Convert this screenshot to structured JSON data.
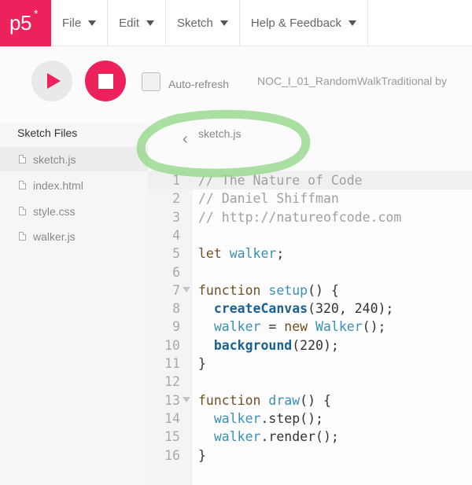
{
  "app": {
    "logo": "p5",
    "logo_star": "*",
    "brand_color": "#ed225d"
  },
  "nav": {
    "menus": [
      {
        "label": "File"
      },
      {
        "label": "Edit"
      },
      {
        "label": "Sketch"
      },
      {
        "label": "Help & Feedback"
      }
    ]
  },
  "toolbar": {
    "play_icon": "play-icon",
    "stop_icon": "stop-icon",
    "auto_refresh_label": "Auto-refresh",
    "auto_refresh_checked": false,
    "project_name": "NOC_I_01_RandomWalkTraditional  by"
  },
  "sidebar": {
    "title": "Sketch Files",
    "files": [
      {
        "name": "sketch.js",
        "active": true
      },
      {
        "name": "index.html",
        "active": false
      },
      {
        "name": "style.css",
        "active": false
      },
      {
        "name": "walker.js",
        "active": false
      }
    ]
  },
  "editor": {
    "back_icon": "chevron-left-icon",
    "open_file": "sketch.js",
    "highlight_color": "#9ad98f",
    "lines": [
      {
        "n": "1",
        "fold": false,
        "tokens": [
          {
            "t": "// The Nature of Code",
            "c": "comment"
          }
        ]
      },
      {
        "n": "2",
        "fold": false,
        "tokens": [
          {
            "t": "// Daniel Shiffman",
            "c": "comment"
          }
        ]
      },
      {
        "n": "3",
        "fold": false,
        "tokens": [
          {
            "t": "// http://natureofcode.com",
            "c": "comment"
          }
        ]
      },
      {
        "n": "4",
        "fold": false,
        "tokens": []
      },
      {
        "n": "5",
        "fold": false,
        "tokens": [
          {
            "t": "let ",
            "c": "kw"
          },
          {
            "t": "walker",
            "c": "var"
          },
          {
            "t": ";",
            "c": ""
          }
        ]
      },
      {
        "n": "6",
        "fold": false,
        "tokens": []
      },
      {
        "n": "7",
        "fold": true,
        "tokens": [
          {
            "t": "function ",
            "c": "kw"
          },
          {
            "t": "setup",
            "c": "var"
          },
          {
            "t": "() {",
            "c": ""
          }
        ]
      },
      {
        "n": "8",
        "fold": false,
        "tokens": [
          {
            "t": "  ",
            "c": ""
          },
          {
            "t": "createCanvas",
            "c": "fn"
          },
          {
            "t": "(320, 240);",
            "c": ""
          }
        ]
      },
      {
        "n": "9",
        "fold": false,
        "tokens": [
          {
            "t": "  ",
            "c": ""
          },
          {
            "t": "walker",
            "c": "var"
          },
          {
            "t": " = ",
            "c": ""
          },
          {
            "t": "new ",
            "c": "new"
          },
          {
            "t": "Walker",
            "c": "var"
          },
          {
            "t": "();",
            "c": ""
          }
        ]
      },
      {
        "n": "10",
        "fold": false,
        "tokens": [
          {
            "t": "  ",
            "c": ""
          },
          {
            "t": "background",
            "c": "fn"
          },
          {
            "t": "(220);",
            "c": ""
          }
        ]
      },
      {
        "n": "11",
        "fold": false,
        "tokens": [
          {
            "t": "}",
            "c": ""
          }
        ]
      },
      {
        "n": "12",
        "fold": false,
        "tokens": []
      },
      {
        "n": "13",
        "fold": true,
        "tokens": [
          {
            "t": "function ",
            "c": "kw"
          },
          {
            "t": "draw",
            "c": "var"
          },
          {
            "t": "() {",
            "c": ""
          }
        ]
      },
      {
        "n": "14",
        "fold": false,
        "tokens": [
          {
            "t": "  ",
            "c": ""
          },
          {
            "t": "walker",
            "c": "var"
          },
          {
            "t": ".step();",
            "c": ""
          }
        ]
      },
      {
        "n": "15",
        "fold": false,
        "tokens": [
          {
            "t": "  ",
            "c": ""
          },
          {
            "t": "walker",
            "c": "var"
          },
          {
            "t": ".render();",
            "c": ""
          }
        ]
      },
      {
        "n": "16",
        "fold": false,
        "tokens": [
          {
            "t": "}",
            "c": ""
          }
        ]
      }
    ]
  }
}
